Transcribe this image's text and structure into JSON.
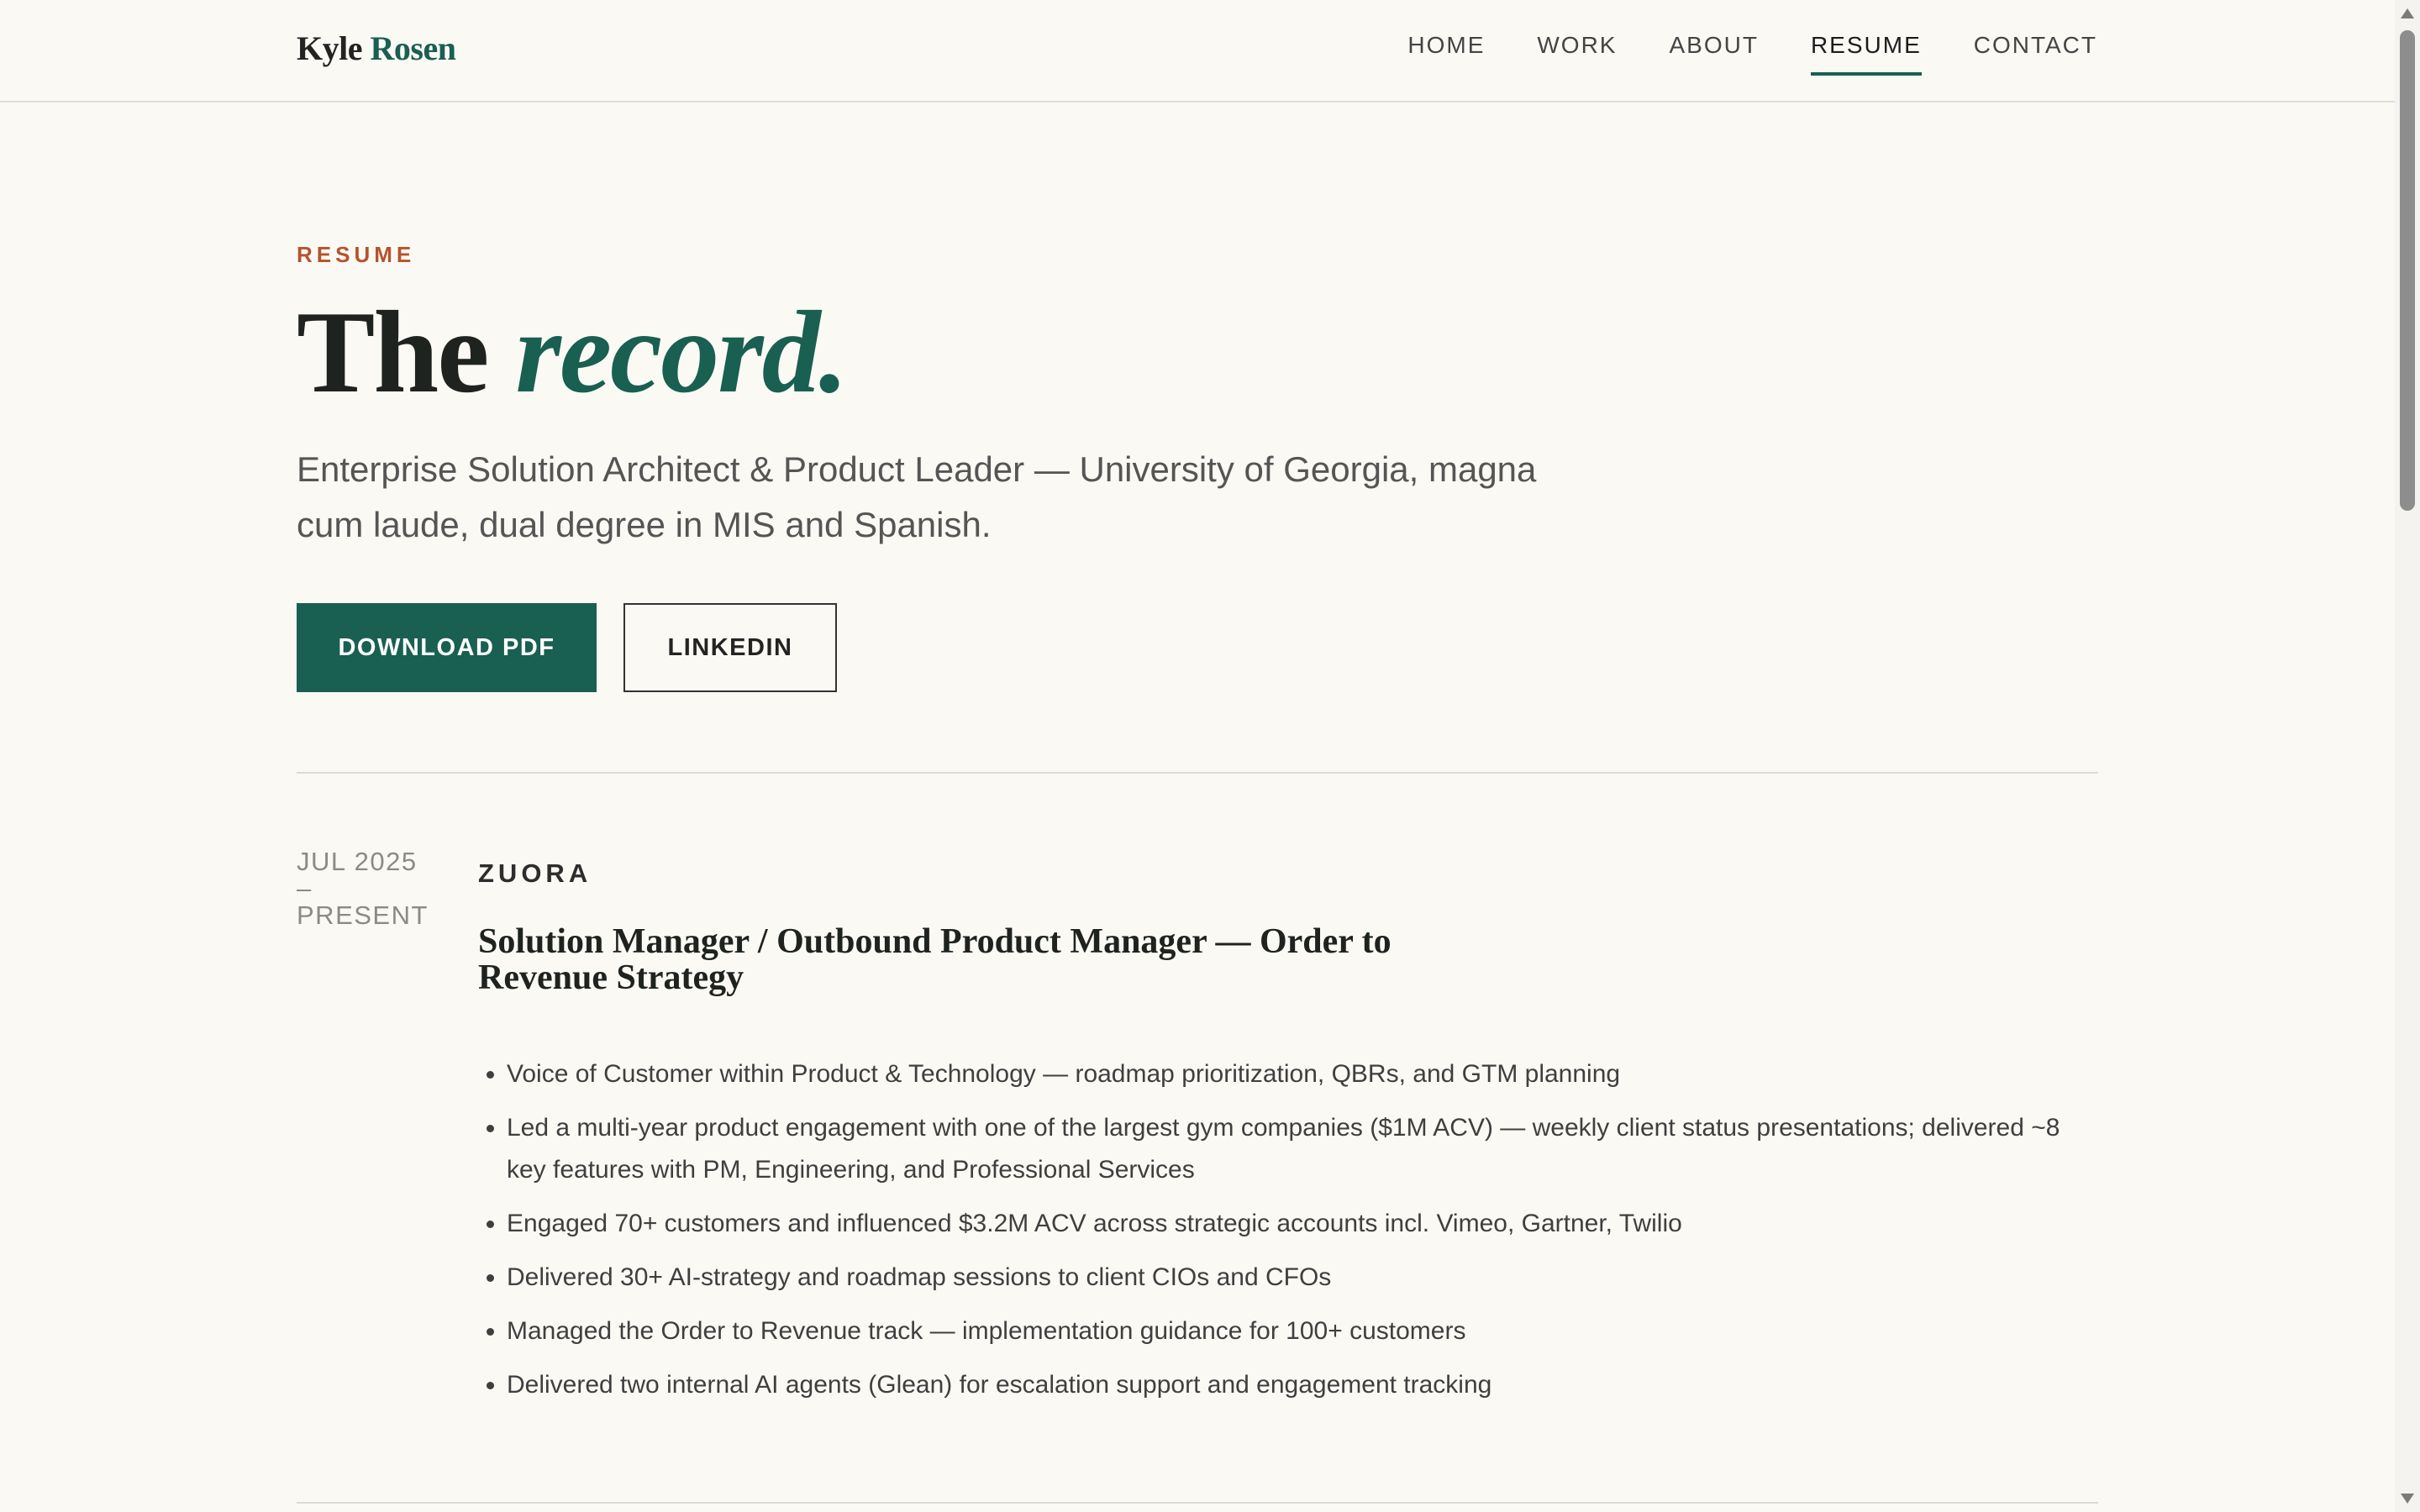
{
  "header": {
    "logo_first": "Kyle",
    "logo_last": "Rosen",
    "nav": [
      {
        "label": "HOME",
        "active": false
      },
      {
        "label": "WORK",
        "active": false
      },
      {
        "label": "ABOUT",
        "active": false
      },
      {
        "label": "RESUME",
        "active": true
      },
      {
        "label": "CONTACT",
        "active": false
      }
    ]
  },
  "hero": {
    "eyebrow": "RESUME",
    "headline_plain": "The",
    "headline_accent": "record.",
    "subtitle": "Enterprise Solution Architect & Product Leader — University of Georgia, magna cum laude, dual degree in MIS and Spanish.",
    "buttons": {
      "primary": "DOWNLOAD PDF",
      "secondary": "LINKEDIN"
    }
  },
  "experience": [
    {
      "start": "JUL 2025",
      "dash": "–",
      "end": "PRESENT",
      "company": "ZUORA",
      "role": "Solution Manager / Outbound Product Manager — Order to Revenue Strategy",
      "bullets": [
        "Voice of Customer within Product & Technology — roadmap prioritization, QBRs, and GTM planning",
        "Led a multi-year product engagement with one of the largest gym companies ($1M ACV) — weekly client status presentations; delivered ~8 key features with PM, Engineering, and Professional Services",
        "Engaged 70+ customers and influenced $3.2M ACV across strategic accounts incl. Vimeo, Gartner, Twilio",
        "Delivered 30+ AI-strategy and roadmap sessions to client CIOs and CFOs",
        "Managed the Order to Revenue track — implementation guidance for 100+ customers",
        "Delivered two internal AI agents (Glean) for escalation support and engagement tracking"
      ]
    }
  ],
  "theme": {
    "accent": "#195f52",
    "eyebrow": "#b5532e",
    "background": "#fbf9f4"
  }
}
